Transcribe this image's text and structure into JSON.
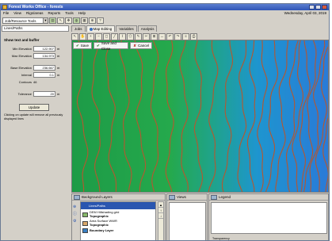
{
  "window": {
    "title": "Forest Works Office - forests"
  },
  "menu": {
    "items": [
      "File",
      "View",
      "Rigs/areas",
      "Reports",
      "Tools",
      "Help"
    ],
    "date": "Wednesday, April 03, 2019"
  },
  "toolbar": {
    "combo_value": "Job/Resource Tools"
  },
  "left_panel": {
    "header": "Lines/Paths",
    "section_title": "Show text and buffer",
    "fields": [
      {
        "label": "Min Elevation",
        "value": "122.907",
        "unit": "m"
      },
      {
        "label": "Max Elevation",
        "value": "134.973",
        "unit": "m"
      },
      {
        "label": "Base Elevation",
        "value": "236.667",
        "unit": "m"
      },
      {
        "label": "Interval",
        "value": "0.1",
        "unit": "m"
      }
    ],
    "contours_label": "Contours",
    "contours_value": "46",
    "tolerance_label": "Tolerance",
    "tolerance_value": "20",
    "tolerance_unit": "m",
    "update_button": "Update",
    "hint": "Clicking on update will remove all previously displayed lines"
  },
  "tabs": [
    {
      "label": "Jobs",
      "active": false
    },
    {
      "label": "Map Editing",
      "active": true
    },
    {
      "label": "Variables",
      "active": false
    },
    {
      "label": "Analysis",
      "active": false
    }
  ],
  "map_toolbar": {
    "save": "Save",
    "save_and_close": "Save and Close",
    "cancel": "Cancel"
  },
  "layers_panel": {
    "title": "Background Layers",
    "items": [
      {
        "label": "Lines/Paths",
        "swatch": "#2a56b0",
        "selected": true
      },
      {
        "label": "DEM Hillshading grid",
        "sub": "Topographic",
        "swatch": "#86b86a"
      },
      {
        "label": "Area Surface WWR",
        "sub": "Topographic",
        "swatch": "#d9a76a"
      },
      {
        "label": "Boundary Layer",
        "sub": "",
        "swatch": "#3a7fc4"
      }
    ]
  },
  "views_panel": {
    "title": "Views"
  },
  "legend_panel": {
    "title": "Legend",
    "transparency_label": "Transparency"
  },
  "colors": {
    "map_green": "#1fa04b",
    "map_blue": "#1f8fd6",
    "contour": "#b6572f",
    "accent": "#2a56b0"
  }
}
